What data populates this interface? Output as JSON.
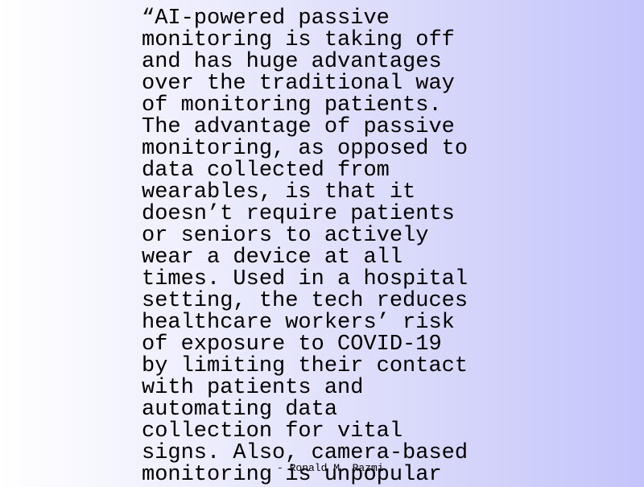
{
  "slide": {
    "background_colors": [
      "#ffffff",
      "#c4c4fb"
    ],
    "text_color": "#000000",
    "quote": {
      "lines": [
        "“AI-powered passive",
        "monitoring is taking off",
        "and has huge advantages",
        "over the traditional way",
        "of monitoring patients.",
        "The advantage of passive",
        "monitoring, as opposed to",
        "data collected from",
        "wearables, is that it",
        "doesn’t require patients",
        "or seniors to actively",
        "wear a device at all",
        "times. Used in a hospital",
        "setting, the tech reduces",
        "healthcare workers’ risk",
        "of exposure to COVID-19",
        "by limiting their contact",
        "with patients and",
        "automating data",
        "collection for vital",
        "signs. Also, camera-based",
        "monitoring is unpopular"
      ]
    },
    "attribution": "- Ronald M. Razmi"
  }
}
